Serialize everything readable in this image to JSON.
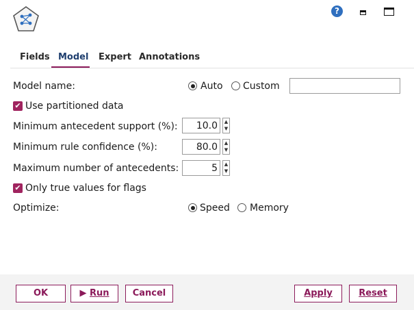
{
  "window": {
    "help_icon": "help-icon",
    "help_glyph": "?",
    "minimize_icon": "minimize-icon",
    "maximize_icon": "maximize-icon"
  },
  "tabs": [
    {
      "label": "Fields"
    },
    {
      "label": "Model",
      "active": true
    },
    {
      "label": "Expert"
    },
    {
      "label": "Annotations"
    }
  ],
  "model_name": {
    "label": "Model name:",
    "auto_label": "Auto",
    "custom_label": "Custom",
    "selected": "Auto",
    "custom_value": ""
  },
  "use_partitioned": {
    "label": "Use partitioned data",
    "checked": true
  },
  "min_antecedent_support": {
    "label": "Minimum antecedent support (%):",
    "value": "10.0"
  },
  "min_rule_confidence": {
    "label": "Minimum rule confidence (%):",
    "value": "80.0"
  },
  "max_antecedents": {
    "label": "Maximum number of antecedents:",
    "value": "5"
  },
  "only_true_flags": {
    "label": "Only true values for flags",
    "checked": true
  },
  "optimize": {
    "label": "Optimize:",
    "speed_label": "Speed",
    "memory_label": "Memory",
    "selected": "Speed"
  },
  "buttons": {
    "ok": "OK",
    "run": "Run",
    "cancel": "Cancel",
    "apply": "Apply",
    "reset": "Reset"
  },
  "colors": {
    "accent": "#8b1a5a",
    "checkbox": "#a0245f",
    "help": "#2f6fbf"
  }
}
